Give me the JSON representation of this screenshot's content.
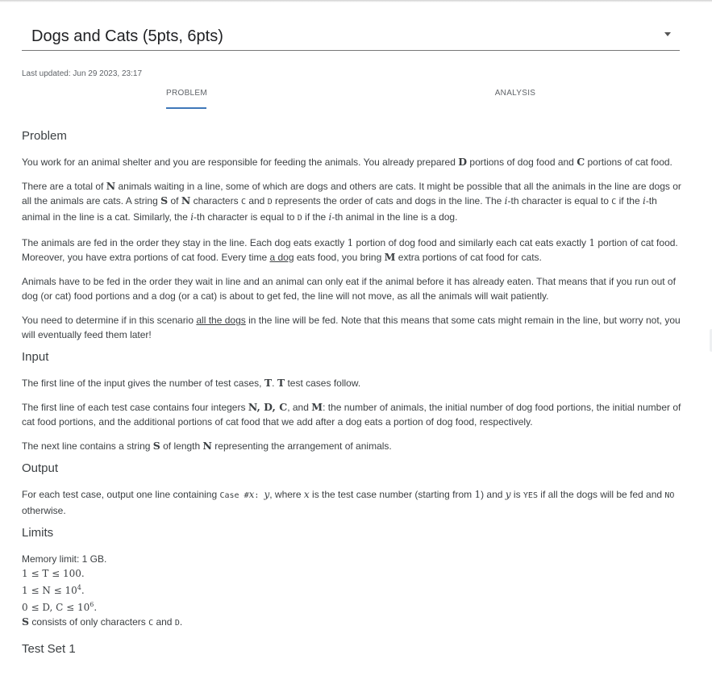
{
  "header": {
    "title": "Dogs and Cats (5pts, 6pts)",
    "last_updated": "Last updated: Jun 29 2023, 23:17"
  },
  "tabs": [
    {
      "label": "PROBLEM",
      "active": true
    },
    {
      "label": "ANALYSIS",
      "active": false
    }
  ],
  "sections": {
    "problem": {
      "heading": "Problem",
      "p1": {
        "a": "You work for an animal shelter and you are responsible for feeding the animals. You already prepared ",
        "D": "D",
        "b": " portions of dog food and ",
        "C": "C",
        "c": " portions of cat food."
      },
      "p2": {
        "a": "There are a total of ",
        "N": "N",
        "b": " animals waiting in a line, some of which are dogs and others are cats. It might be possible that all the animals in the line are dogs or all the animals are cats. A string ",
        "S": "S",
        "c": " of ",
        "N2": "N",
        "d": " characters ",
        "C_code": "C",
        "e": " and ",
        "D_code": "D",
        "f": " represents the order of cats and dogs in the line. The ",
        "i1": "i",
        "g": "-th character is equal to ",
        "C_code2": "C",
        "h": " if the ",
        "i2": "i",
        "j": "-th animal in the line is a cat. Similarly, the ",
        "i3": "i",
        "k": "-th character is equal to ",
        "D_code2": "D",
        "l": " if the ",
        "i4": "i",
        "m": "-th animal in the line is a dog."
      },
      "p3": {
        "a": "The animals are fed in the order they stay in the line. Each dog eats exactly ",
        "one1": "1",
        "b": " portion of dog food and similarly each cat eats exactly ",
        "one2": "1",
        "c": " portion of cat food. Moreover, you have extra portions of cat food. Every time ",
        "u": "a dog",
        "d": " eats food, you bring ",
        "M": "M",
        "e": " extra portions of cat food for cats."
      },
      "p4": "Animals have to be fed in the order they wait in line and an animal can only eat if the animal before it has already eaten. That means that if you run out of dog (or cat) food portions and a dog (or a cat) is about to get fed, the line will not move, as all the animals will wait patiently.",
      "p5": {
        "a": "You need to determine if in this scenario ",
        "u": "all the dogs",
        "b": " in the line will be fed. Note that this means that some cats might remain in the line, but worry not, you will eventually feed them later!"
      }
    },
    "input": {
      "heading": "Input",
      "p1": {
        "a": "The first line of the input gives the number of test cases, ",
        "T1": "T",
        "b": ". ",
        "T2": "T",
        "c": " test cases follow."
      },
      "p2": {
        "a": "The first line of each test case contains four integers ",
        "vars": "N, D, C",
        "b": ", and ",
        "M": "M",
        "c": ": the number of animals, the initial number of dog food portions, the initial number of cat food portions, and the additional portions of cat food that we add after a dog eats a portion of dog food, respectively."
      },
      "p3": {
        "a": "The next line contains a string ",
        "S": "S",
        "b": " of length ",
        "N": "N",
        "c": " representing the arrangement of animals."
      }
    },
    "output": {
      "heading": "Output",
      "p1": {
        "a": "For each test case, output one line containing ",
        "code1": "Case #",
        "x": "x",
        "code2": ": ",
        "y": "y",
        "b": ", where ",
        "x2": "x",
        "c": " is the test case number (starting from ",
        "one": "1",
        "d": ") and ",
        "y2": "y",
        "e": " is ",
        "yes": "YES",
        "f": " if all the dogs will be fed and ",
        "no": "NO",
        "g": " otherwise."
      }
    },
    "limits": {
      "heading": "Limits",
      "memory": "Memory limit: 1 GB.",
      "l1": "1 ≤ T ≤ 100.",
      "l2_base": "1 ≤ N ≤ 10",
      "l2_exp": "4",
      "l3_base": "0 ≤ D, C ≤ 10",
      "l3_exp": "6",
      "l4": {
        "S": "S",
        "a": " consists of only characters ",
        "C": "C",
        "b": " and ",
        "D": "D",
        "c": "."
      }
    },
    "testset": {
      "heading": "Test Set 1"
    }
  }
}
